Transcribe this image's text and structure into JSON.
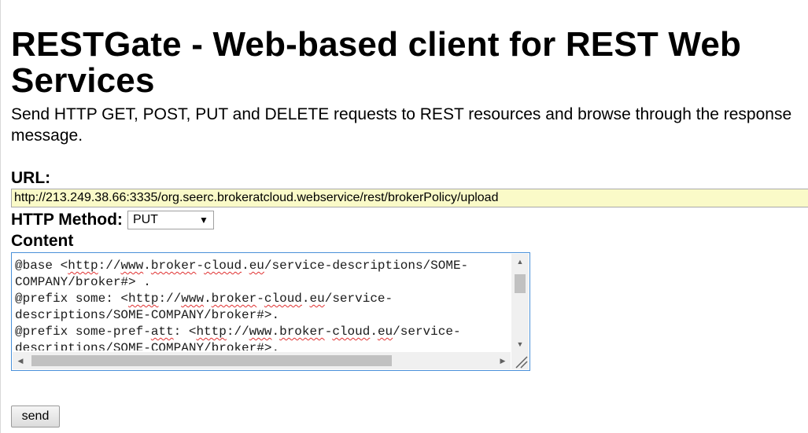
{
  "page": {
    "title": "RESTGate - Web-based client for REST Web Services",
    "subtitle": "Send HTTP GET, POST, PUT and DELETE requests to REST resources and browse through the response message."
  },
  "form": {
    "url_label": "URL:",
    "url_value": "http://213.249.38.66:3335/org.seerc.brokeratcloud.webservice/rest/brokerPolicy/upload",
    "method_label": "HTTP Method:",
    "method_selected": "PUT",
    "content_label": "Content",
    "content_lines": [
      "@base <http://www.broker-cloud.eu/service-descriptions/SOME-",
      "COMPANY/broker#> .",
      "@prefix some: <http://www.broker-cloud.eu/service-",
      "descriptions/SOME-COMPANY/broker#>.",
      "@prefix some-pref-att: <http://www.broker-cloud.eu/service-",
      "descriptions/SOME-COMPANY/broker#>."
    ],
    "send_label": "send"
  },
  "icons": {
    "select_arrow": "▼",
    "scroll_up": "▲",
    "scroll_down": "▼",
    "scroll_left": "◀",
    "scroll_right": "▶"
  },
  "colors": {
    "url_background": "#fafac8",
    "textarea_focus_border": "#4a90d9",
    "spellcheck_underline": "#e03030"
  }
}
